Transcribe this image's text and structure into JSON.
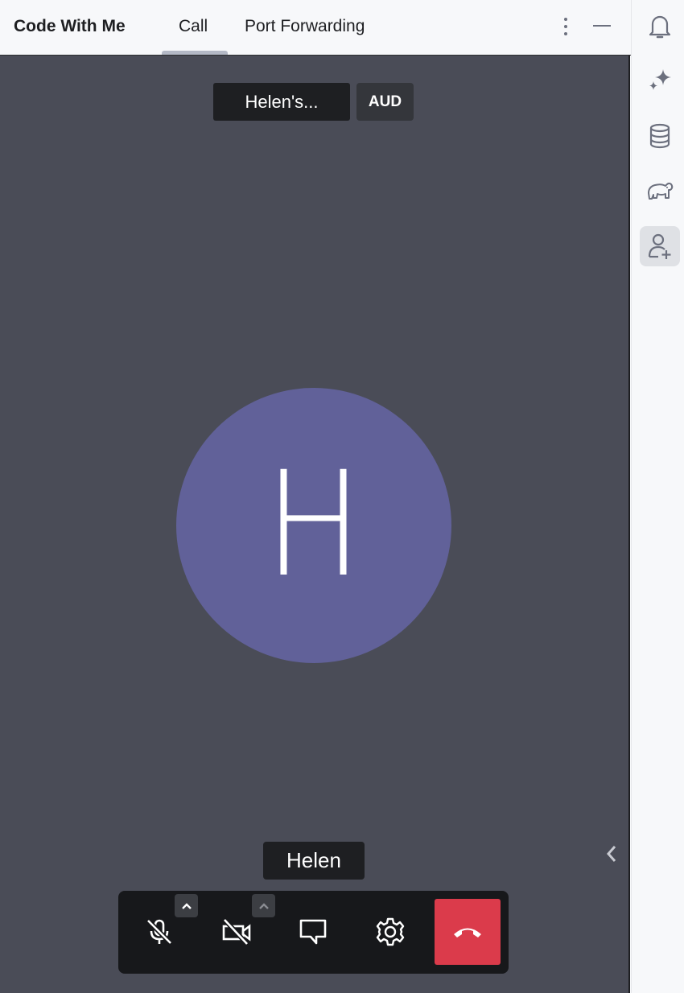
{
  "header": {
    "title": "Code With Me",
    "tabs": [
      {
        "label": "Call",
        "active": true
      },
      {
        "label": "Port Forwarding",
        "active": false
      }
    ],
    "icons": [
      "more-vertical-icon",
      "minimize-icon"
    ]
  },
  "sidebar": {
    "items": [
      {
        "name": "notifications",
        "icon": "bell-icon",
        "active": false
      },
      {
        "name": "ai-assistant",
        "icon": "sparkle-icon",
        "active": false
      },
      {
        "name": "database",
        "icon": "database-icon",
        "active": false
      },
      {
        "name": "gradle",
        "icon": "elephant-icon",
        "active": false
      },
      {
        "name": "code-with-me",
        "icon": "add-user-icon",
        "active": true
      }
    ]
  },
  "call": {
    "window_name": "Helen's...",
    "audio_badge": "AUD",
    "avatar_initial": "H",
    "avatar_color": "#616199",
    "speaker_name": "Helen",
    "controls": [
      {
        "name": "microphone",
        "icon": "mic-off-icon",
        "state": "muted"
      },
      {
        "name": "camera",
        "icon": "video-off-icon",
        "state": "off"
      },
      {
        "name": "chat",
        "icon": "chat-icon"
      },
      {
        "name": "settings",
        "icon": "gear-icon"
      },
      {
        "name": "hang-up",
        "icon": "phone-hangup-icon",
        "color": "#db3b4b"
      }
    ]
  }
}
